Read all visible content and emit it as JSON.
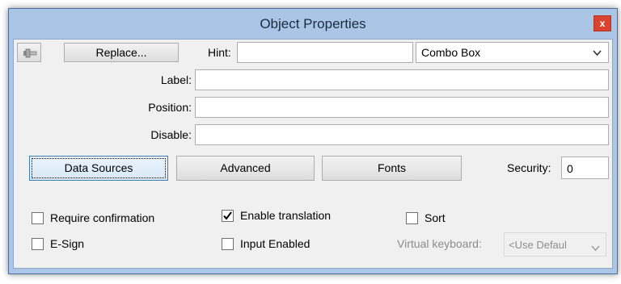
{
  "window": {
    "title": "Object Properties",
    "close_label": "x"
  },
  "toolbar": {
    "pin_icon": "pin-icon",
    "replace_label": "Replace...",
    "hint_label": "Hint:",
    "hint_value": "",
    "type_selected": "Combo Box"
  },
  "fields": {
    "label_label": "Label:",
    "label_value": "",
    "position_label": "Position:",
    "position_value": "",
    "disable_label": "Disable:",
    "disable_value": ""
  },
  "tabs": {
    "data_sources": "Data Sources",
    "advanced": "Advanced",
    "fonts": "Fonts"
  },
  "security": {
    "label": "Security:",
    "value": "0"
  },
  "options": {
    "require_confirmation": {
      "label": "Require confirmation",
      "checked": false
    },
    "enable_translation": {
      "label": "Enable translation",
      "checked": true
    },
    "sort": {
      "label": "Sort",
      "checked": false
    },
    "e_sign": {
      "label": "E-Sign",
      "checked": false
    },
    "input_enabled": {
      "label": "Input Enabled",
      "checked": false
    },
    "virtual_keyboard_label": "Virtual keyboard:",
    "virtual_keyboard_selected": "<Use Defaul"
  },
  "colors": {
    "frame": "#aac5e6",
    "client": "#f0f0f0",
    "close": "#d9432f"
  }
}
